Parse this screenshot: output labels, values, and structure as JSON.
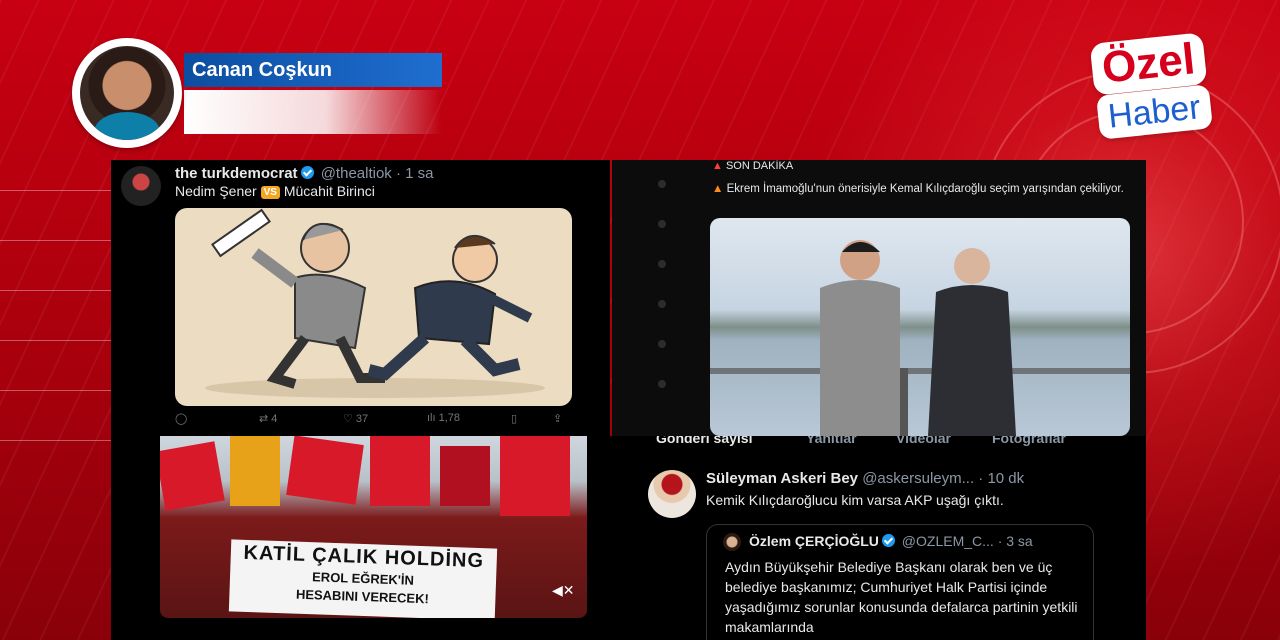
{
  "author": {
    "name": "Canan Coşkun"
  },
  "logo": {
    "line1": "Özel",
    "line2": "Haber"
  },
  "tweet1": {
    "name": "the turkdemocrat",
    "handle": "@thealtiok",
    "time": "· 1 sa",
    "text_a": "Nedim Şener",
    "vs": "VS",
    "text_b": "Mücahit Birinci",
    "stats": {
      "retweets": "4",
      "likes": "37",
      "views": "1,78"
    }
  },
  "tweet2": {
    "breaking": "SON DAKİKA",
    "text": "Ekrem İmamoğlu'nun önerisiyle Kemal Kılıçdaroğlu seçim yarışından çekiliyor."
  },
  "protest": {
    "banner_line1": "KATİL ÇALIK HOLDİNG",
    "banner_line2": "EROL EĞREK'İN",
    "banner_line3": "HESABINI VERECEK!"
  },
  "tweet4": {
    "tabs": [
      "Gönderi sayısı",
      "Yanıtlar",
      "Videolar",
      "Fotoğraflar"
    ],
    "name": "Süleyman Askeri Bey",
    "handle": "@askersuleym...",
    "time": "· 10 dk",
    "text": "Kemik Kılıçdaroğlucu kim varsa AKP uşağı çıktı.",
    "quote": {
      "name": "Özlem ÇERÇİOĞLU",
      "handle": "@OZLEM_C...",
      "time": "· 3 sa",
      "text": "Aydın Büyükşehir Belediye Başkanı olarak ben ve üç belediye başkanımız; Cumhuriyet Halk Partisi içinde yaşadığımız sorunlar konusunda defalarca partinin yetkili makamlarında"
    }
  },
  "colors": {
    "brand_red": "#d6001c",
    "brand_blue": "#1d5fcf",
    "verified": "#1d9bf0"
  }
}
